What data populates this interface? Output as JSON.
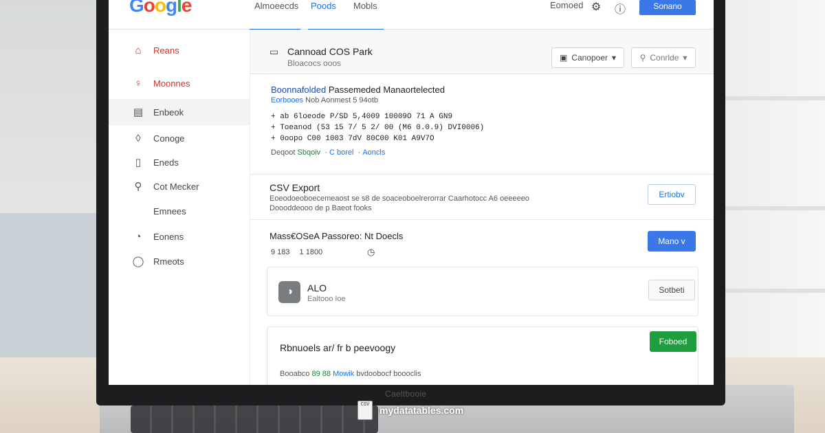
{
  "header": {
    "logo": {
      "g1": "G",
      "o1": "o",
      "o2": "o",
      "g2": "g",
      "l": "l",
      "e": "e"
    },
    "tabs": [
      {
        "label": "Almoeecds"
      },
      {
        "label": "Poods",
        "active": true
      },
      {
        "label": "Mobls"
      }
    ],
    "link": "Eomoed",
    "primary_button": "Sonano",
    "icons": [
      "gear-icon",
      "help-icon"
    ]
  },
  "sidebar": {
    "items": [
      {
        "label": "Reans",
        "icon": "home-icon",
        "style": "red"
      },
      {
        "label": "Moonnes",
        "icon": "people-icon",
        "style": "red"
      },
      {
        "label": "Enbeok",
        "icon": "document-icon",
        "selected": true
      },
      {
        "label": "Conoge",
        "icon": "shield-icon"
      },
      {
        "label": "Eneds",
        "icon": "book-icon"
      },
      {
        "label": "Cot Mecker",
        "icon": "search-icon"
      },
      {
        "label": "Emnees",
        "icon": ""
      },
      {
        "label": "Eonens",
        "icon": "clock-icon"
      },
      {
        "label": "Rmeots",
        "icon": "chat-icon"
      }
    ]
  },
  "page": {
    "title": "Cannoad COS Park",
    "subtitle": "Bloacocs ooos",
    "buttons": [
      "Canopoer",
      "Conrlde"
    ]
  },
  "card1": {
    "title_blue": "Boonnafolded",
    "title_rest": " Passemeded Manaortelected",
    "sub_blue": "Eorbooes",
    "sub_rest": " Nob Aonmest 5 94otb",
    "lines": [
      "+ ab 6loeode P/SD  5,4009  10009O 71 A GN9",
      "+ Toeanod  (53 15 7/  5 2/ 00  (M6 0.0.9) DVI0006)",
      "+ 0oopo  C00 1003 7dV  80C00 K01 A9V7O"
    ],
    "tag_prefix": "Deqoot",
    "tag_green": "Sbqoiv",
    "tag_blue1": "C borel",
    "tag_blue2": "Aoncls"
  },
  "csv": {
    "title": "CSV Export",
    "desc_line1": "Eoeodoeoboecemeaost se s8 de soaceoboelrerorrar Caarhotocc A6 oeeeeeo",
    "desc_line2": "Doooddeooo de p Baeot fooks",
    "button": "Ertiobv"
  },
  "mass": {
    "title": "Mass€OSeA Passoreo: Nt Doecls",
    "meta1": "9  183",
    "meta2": "1  1800",
    "button": "Mano v"
  },
  "card2": {
    "title": "ALO",
    "subtitle": "Ealtooo Ioe",
    "button": "Sotbeti"
  },
  "card3": {
    "title": "Rbnuoels ar/ fr b peevoogy",
    "button": "Foboed",
    "foot_pre": "Booabco ",
    "foot_green": "89 88",
    "foot_blue": " Mowik",
    "foot_rest": " bvdoobocf boooclis"
  },
  "laptop_brand": "Caeltbooie",
  "watermark": {
    "icon_text": "CSV",
    "text": "mydatatables.com"
  }
}
